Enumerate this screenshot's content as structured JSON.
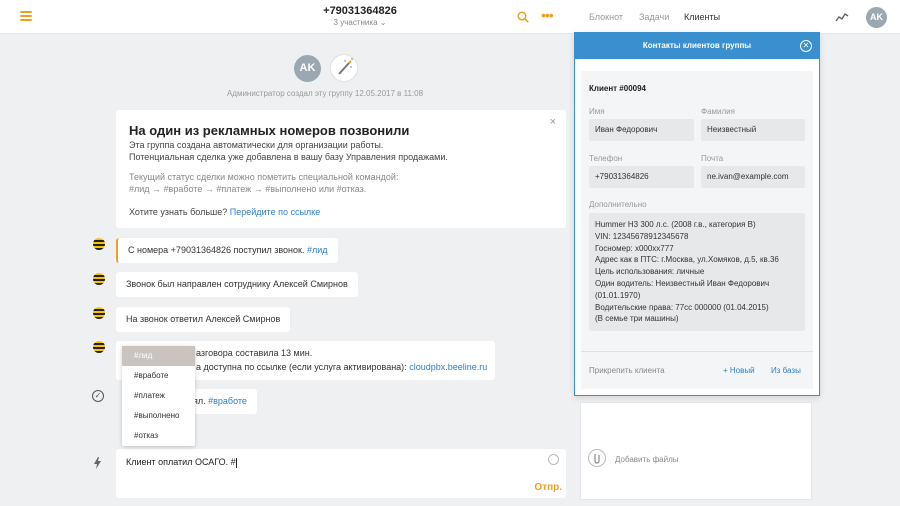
{
  "header": {
    "phone": "+79031364826",
    "participants": "3 участника",
    "tabs": [
      "Блокнот",
      "Задачи",
      "Клиенты"
    ],
    "active_tab": "Клиенты",
    "avatar_initials": "AK"
  },
  "feed": {
    "avatar_initials": "AK",
    "system_note": "Администратор создал эту группу 12.05.2017 в 11:08",
    "card": {
      "title": "На один из рекламных номеров позвонили",
      "line1": "Эта группа создана автоматически для организации работы.",
      "line2": "Потенциальная сделка уже добавлена в вашу базу Управления продажами.",
      "line3": "Текущий статус сделки можно пометить специальной командой:",
      "line4": "#лид → #вработе → #платеж → #выполнено или #отказ.",
      "question": "Хотите узнать больше?",
      "link": "Перейдите по ссылке",
      "close": "×"
    },
    "messages": [
      {
        "text": "С номера +79031364826 поступил звонок.",
        "tag": "#лид"
      },
      {
        "text": "Звонок был направлен сотруднику Алексей Смирнов"
      },
      {
        "text": "На звонок ответил Алексей Смирнов"
      }
    ],
    "multi": {
      "line1": "азговора составила 13 мин.",
      "line2": "а доступна по ссылке (если услуга активирована):",
      "link": "cloudpbx.beeline.ru"
    },
    "status_msg": {
      "text": "нял.",
      "tag": "#вработе"
    }
  },
  "dropdown": {
    "options": [
      "#лид",
      "#вработе",
      "#платеж",
      "#выполнено",
      "#отказ"
    ],
    "selected": "#лид"
  },
  "composer": {
    "value": "Клиент оплатил ОСАГО. #",
    "send": "Отпр.",
    "attach": "Добавить файлы"
  },
  "panel": {
    "title": "Контакты клиентов группы",
    "client_id": "Клиент #00094",
    "labels": {
      "first_name": "Имя",
      "last_name": "Фамилия",
      "phone": "Телефон",
      "email": "Почта",
      "extra": "Дополнительно"
    },
    "values": {
      "first_name": "Иван Федорович",
      "last_name": "Неизвестный",
      "phone": "+79031364826",
      "email": "ne.ivan@example.com"
    },
    "notes": [
      "Hummer H3 300 л.с. (2008 г.в., категория В)",
      "VIN: 12345678912345678",
      "Госномер: х000хх777",
      "Адрес как в ПТС: г.Москва, ул.Хомяков, д.5, кв.36",
      "Цель использования: личные",
      "Один водитель: Неизвестный Иван Федорович",
      "(01.01.1970)",
      "Водительские права: 77сс 000000 (01.04.2015)",
      "(В семье три машины)"
    ],
    "footer": {
      "attach_label": "Прикрепить клиента",
      "new": "+ Новый",
      "from_db": "Из базы"
    }
  },
  "colors": {
    "accent": "#f0a020",
    "panel_blue": "#3a8fcf",
    "link": "#2e7fc8",
    "beeline": "#f7c20e"
  }
}
